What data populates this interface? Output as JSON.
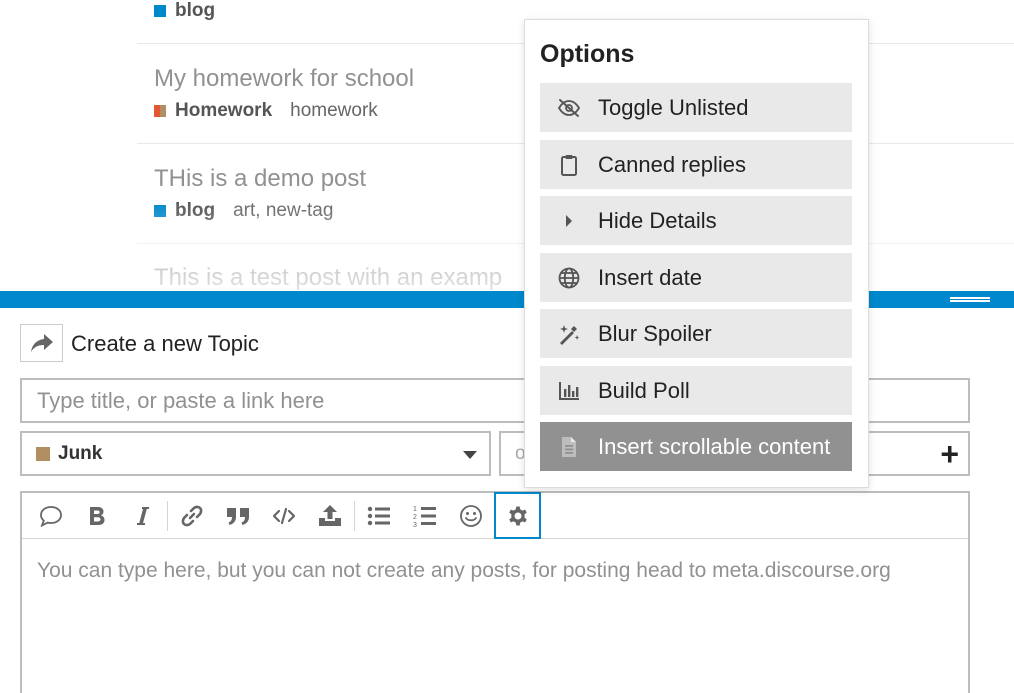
{
  "topics": [
    {
      "title": "",
      "category": "blog",
      "category_color": "#0088cc",
      "tags": ""
    },
    {
      "title": "My homework for school",
      "category": "Homework",
      "category_color": "split",
      "tags": "homework"
    },
    {
      "title": "THis is a demo post",
      "category": "blog",
      "category_color": "#0088cc",
      "tags": "art, new-tag"
    },
    {
      "title": "This is a test post with an examp",
      "category": "",
      "category_color": "",
      "tags": ""
    }
  ],
  "composer": {
    "action_label": "Create a new Topic",
    "title_placeholder": "Type title, or paste a link here",
    "category_selected": "Junk",
    "category_color": "#b28f63",
    "tag_placeholder": "o",
    "editor_text": "You can type here, but you can not create any posts, for posting head to meta.discourse.org",
    "toolbar": [
      "quote-icon",
      "bold-icon",
      "italic-icon",
      "link-icon",
      "blockquote-icon",
      "code-icon",
      "upload-icon",
      "bullet-list-icon",
      "numbered-list-icon",
      "emoji-icon",
      "gear-icon"
    ]
  },
  "options": {
    "title": "Options",
    "items": [
      {
        "label": "Toggle Unlisted",
        "icon": "eye-slash-icon"
      },
      {
        "label": "Canned replies",
        "icon": "clipboard-icon"
      },
      {
        "label": "Hide Details",
        "icon": "caret-right-icon"
      },
      {
        "label": "Insert date",
        "icon": "globe-icon"
      },
      {
        "label": "Blur Spoiler",
        "icon": "magic-icon"
      },
      {
        "label": "Build Poll",
        "icon": "chart-bar-icon"
      },
      {
        "label": "Insert scrollable content",
        "icon": "file-icon",
        "highlighted": true
      }
    ]
  },
  "colors": {
    "accent": "#0088cc",
    "muted": "#919191"
  }
}
